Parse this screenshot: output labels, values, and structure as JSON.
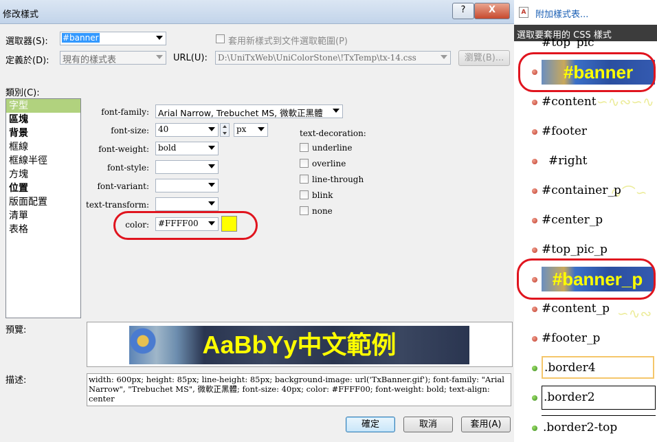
{
  "dialog": {
    "title": "修改樣式",
    "help_label": "?",
    "close_label": "X",
    "selector_label": "選取器(S):",
    "selector_value": "#banner",
    "apply_new_label": "套用新樣式到文件選取範圍(P)",
    "define_in_label": "定義於(D):",
    "define_in_value": "現有的樣式表",
    "url_label": "URL(U):",
    "url_value": "D:\\UniTxWeb\\UniColorStone\\!TxTemp\\tx-14.css",
    "browse_label": "瀏覽(B)...",
    "category_label": "類別(C):",
    "categories": [
      "字型",
      "區塊",
      "背景",
      "框線",
      "框線半徑",
      "方塊",
      "位置",
      "版面配置",
      "清單",
      "表格"
    ],
    "fields": {
      "font_family_label": "font-family:",
      "font_family_value": "Arial Narrow, Trebuchet MS, 微軟正黑體",
      "font_size_label": "font-size:",
      "font_size_value": "40",
      "font_size_unit": "px",
      "font_weight_label": "font-weight:",
      "font_weight_value": "bold",
      "font_style_label": "font-style:",
      "font_variant_label": "font-variant:",
      "text_transform_label": "text-transform:",
      "color_label": "color:",
      "color_value": "#FFFF00"
    },
    "decoration": {
      "label": "text-decoration:",
      "options": [
        "underline",
        "overline",
        "line-through",
        "blink",
        "none"
      ]
    },
    "preview_label": "預覽:",
    "preview_text": "AaBbYy中文範例",
    "desc_label": "描述:",
    "description": "width: 600px; height: 85px; line-height: 85px; background-image: url('TxBanner.gif'); font-family: \"Arial Narrow\", \"Trebuchet MS\", 微軟正黑體; font-size: 40px; color: #FFFF00; font-weight: bold; text-align: center",
    "ok_label": "確定",
    "cancel_label": "取消",
    "apply_label": "套用(A)"
  },
  "panel": {
    "attach_label": "附加樣式表...",
    "header": "選取要套用的 CSS 樣式",
    "rules": [
      "#top_pic",
      "#banner",
      "#content",
      "#footer",
      "#right",
      "#container_p",
      "#center_p",
      "#top_pic_p",
      "#banner_p",
      "#content_p",
      "#footer_p",
      ".border4",
      ".border2",
      ".border2-top"
    ]
  },
  "colors": {
    "accent_yellow": "#FFFF00",
    "highlight_red": "#e0141e",
    "category_selected": "#b1d27e",
    "border4": "#f5c66a"
  }
}
